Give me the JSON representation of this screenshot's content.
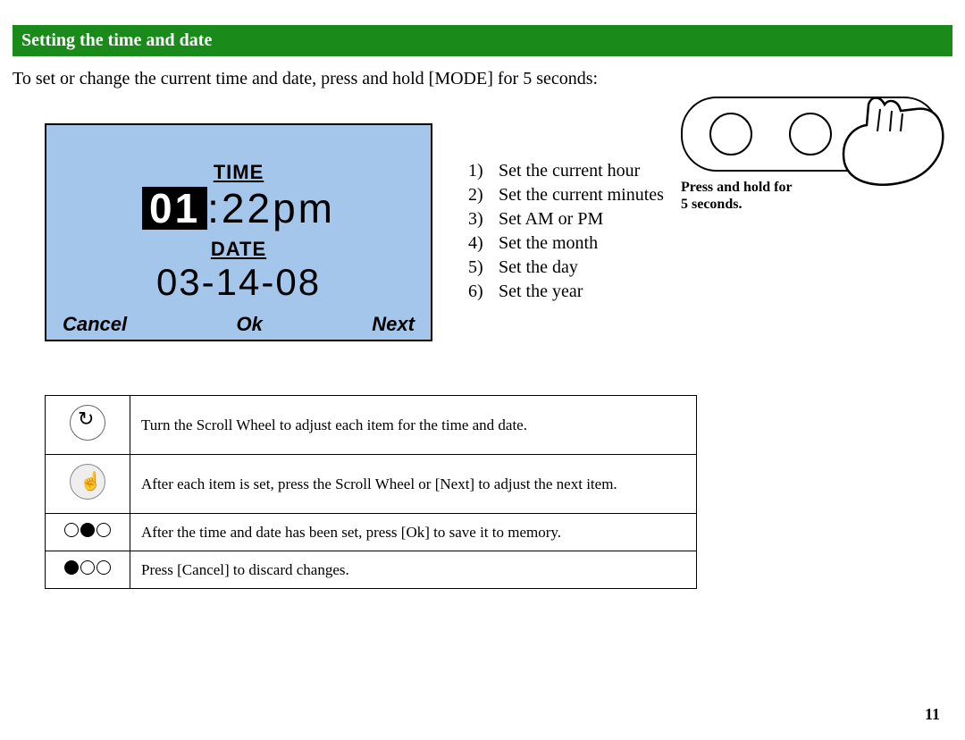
{
  "header": "Setting the time and date",
  "intro": "To set or change the current time and date, press and hold [MODE] for 5 seconds:",
  "lcd": {
    "time_label": "TIME",
    "hour": "01",
    "time_rest": ":22pm",
    "date_label": "DATE",
    "date_value": "03-14-08",
    "cancel": "Cancel",
    "ok": "Ok",
    "next": "Next"
  },
  "steps": [
    "Set the current hour",
    "Set the current minutes",
    "Set AM or PM",
    "Set the month",
    "Set the day",
    "Set the year"
  ],
  "press_caption_line1": "Press and hold for",
  "press_caption_line2": "5 seconds.",
  "instructions": [
    "Turn the Scroll Wheel to adjust each item for the time and date.",
    "After each item is set, press the Scroll Wheel or [Next] to adjust the next item.",
    "After the time and date has been set, press [Ok] to save it to memory.",
    "Press [Cancel] to discard changes."
  ],
  "page_number": "11"
}
